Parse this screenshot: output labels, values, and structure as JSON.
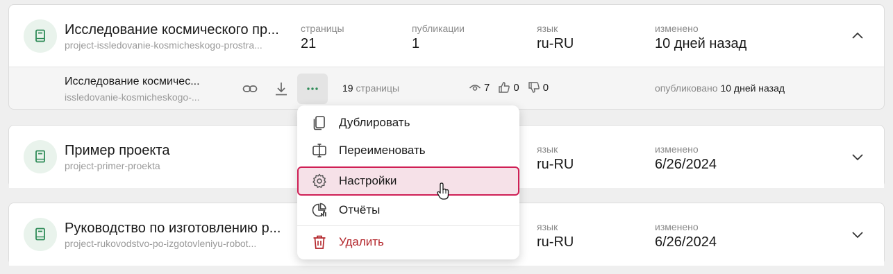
{
  "projects": [
    {
      "title": "Исследование космического пр...",
      "slug": "project-issledovanie-kosmicheskogo-prostra...",
      "meta": [
        {
          "label": "страницы",
          "value": "21"
        },
        {
          "label": "публикации",
          "value": "1"
        },
        {
          "label": "язык",
          "value": "ru-RU"
        },
        {
          "label": "изменено",
          "value": "10 дней назад"
        }
      ],
      "expanded": true,
      "chevron_icon": "chevron-up-icon"
    },
    {
      "title": "Пример проекта",
      "slug": "project-primer-proekta",
      "meta": [
        {
          "label": "язык",
          "value": "ru-RU"
        },
        {
          "label": "изменено",
          "value": "6/26/2024"
        }
      ],
      "chevron_icon": "chevron-down-icon"
    },
    {
      "title": "Руководство по изготовлению р...",
      "slug": "project-rukovodstvo-po-izgotovleniyu-robot...",
      "meta": [
        {
          "label": "язык",
          "value": "ru-RU"
        },
        {
          "label": "изменено",
          "value": "6/26/2024"
        }
      ],
      "chevron_icon": "chevron-down-icon"
    }
  ],
  "version_row": {
    "title": "Исследование космичес...",
    "slug": "issledovanie-kosmicheskogo-...",
    "pages_count": "19",
    "pages_label": "страницы",
    "views": "7",
    "likes": "0",
    "dislikes": "0",
    "published_label": "опубликовано",
    "published_value": "10 дней назад"
  },
  "menu": {
    "items": [
      {
        "label": "Дублировать",
        "icon": "copy-icon"
      },
      {
        "label": "Переименовать",
        "icon": "rename-icon"
      },
      {
        "label": "Настройки",
        "icon": "gear-icon",
        "highlighted": true
      },
      {
        "label": "Отчёты",
        "icon": "report-icon"
      },
      {
        "label": "Удалить",
        "icon": "trash-icon",
        "danger": true
      }
    ]
  },
  "colors": {
    "accent": "#cf1f55",
    "accent_bg": "#f6e1e8",
    "icon_green": "#2e8b57",
    "danger": "#b3262b"
  }
}
